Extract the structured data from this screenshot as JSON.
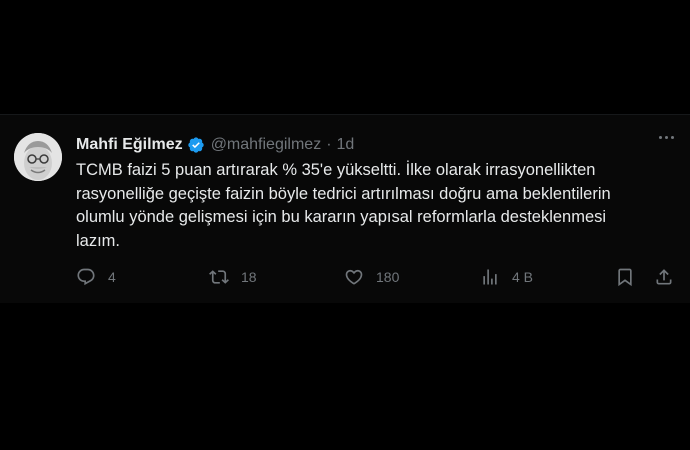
{
  "tweet": {
    "author": {
      "name": "Mahfi Eğilmez",
      "handle": "@mahfiegilmez",
      "verified": true
    },
    "separator": "·",
    "time": "1d",
    "text": "TCMB faizi 5 puan artırarak % 35'e yükseltti. İlke olarak irrasyonellikten\nrasyonelliğe geçişte faizin böyle tedrici artırılması doğru ama beklentilerin\nolumlu yönde gelişmesi için bu kararın yapısal reformlarla desteklenmesi\nlazım.",
    "actions": {
      "reply_count": "4",
      "retweet_count": "18",
      "like_count": "180",
      "views_count": "4 B"
    }
  },
  "icons": {
    "verified": "verified-badge-icon",
    "more": "more-horizontal-icon",
    "reply": "reply-icon",
    "retweet": "retweet-icon",
    "like": "heart-icon",
    "views": "views-chart-icon",
    "bookmark": "bookmark-icon",
    "share": "share-icon"
  },
  "colors": {
    "background": "#000000",
    "tweet_background": "#080808",
    "text": "#e7e9ea",
    "muted": "#71767b",
    "verified": "#1d9bf0"
  }
}
